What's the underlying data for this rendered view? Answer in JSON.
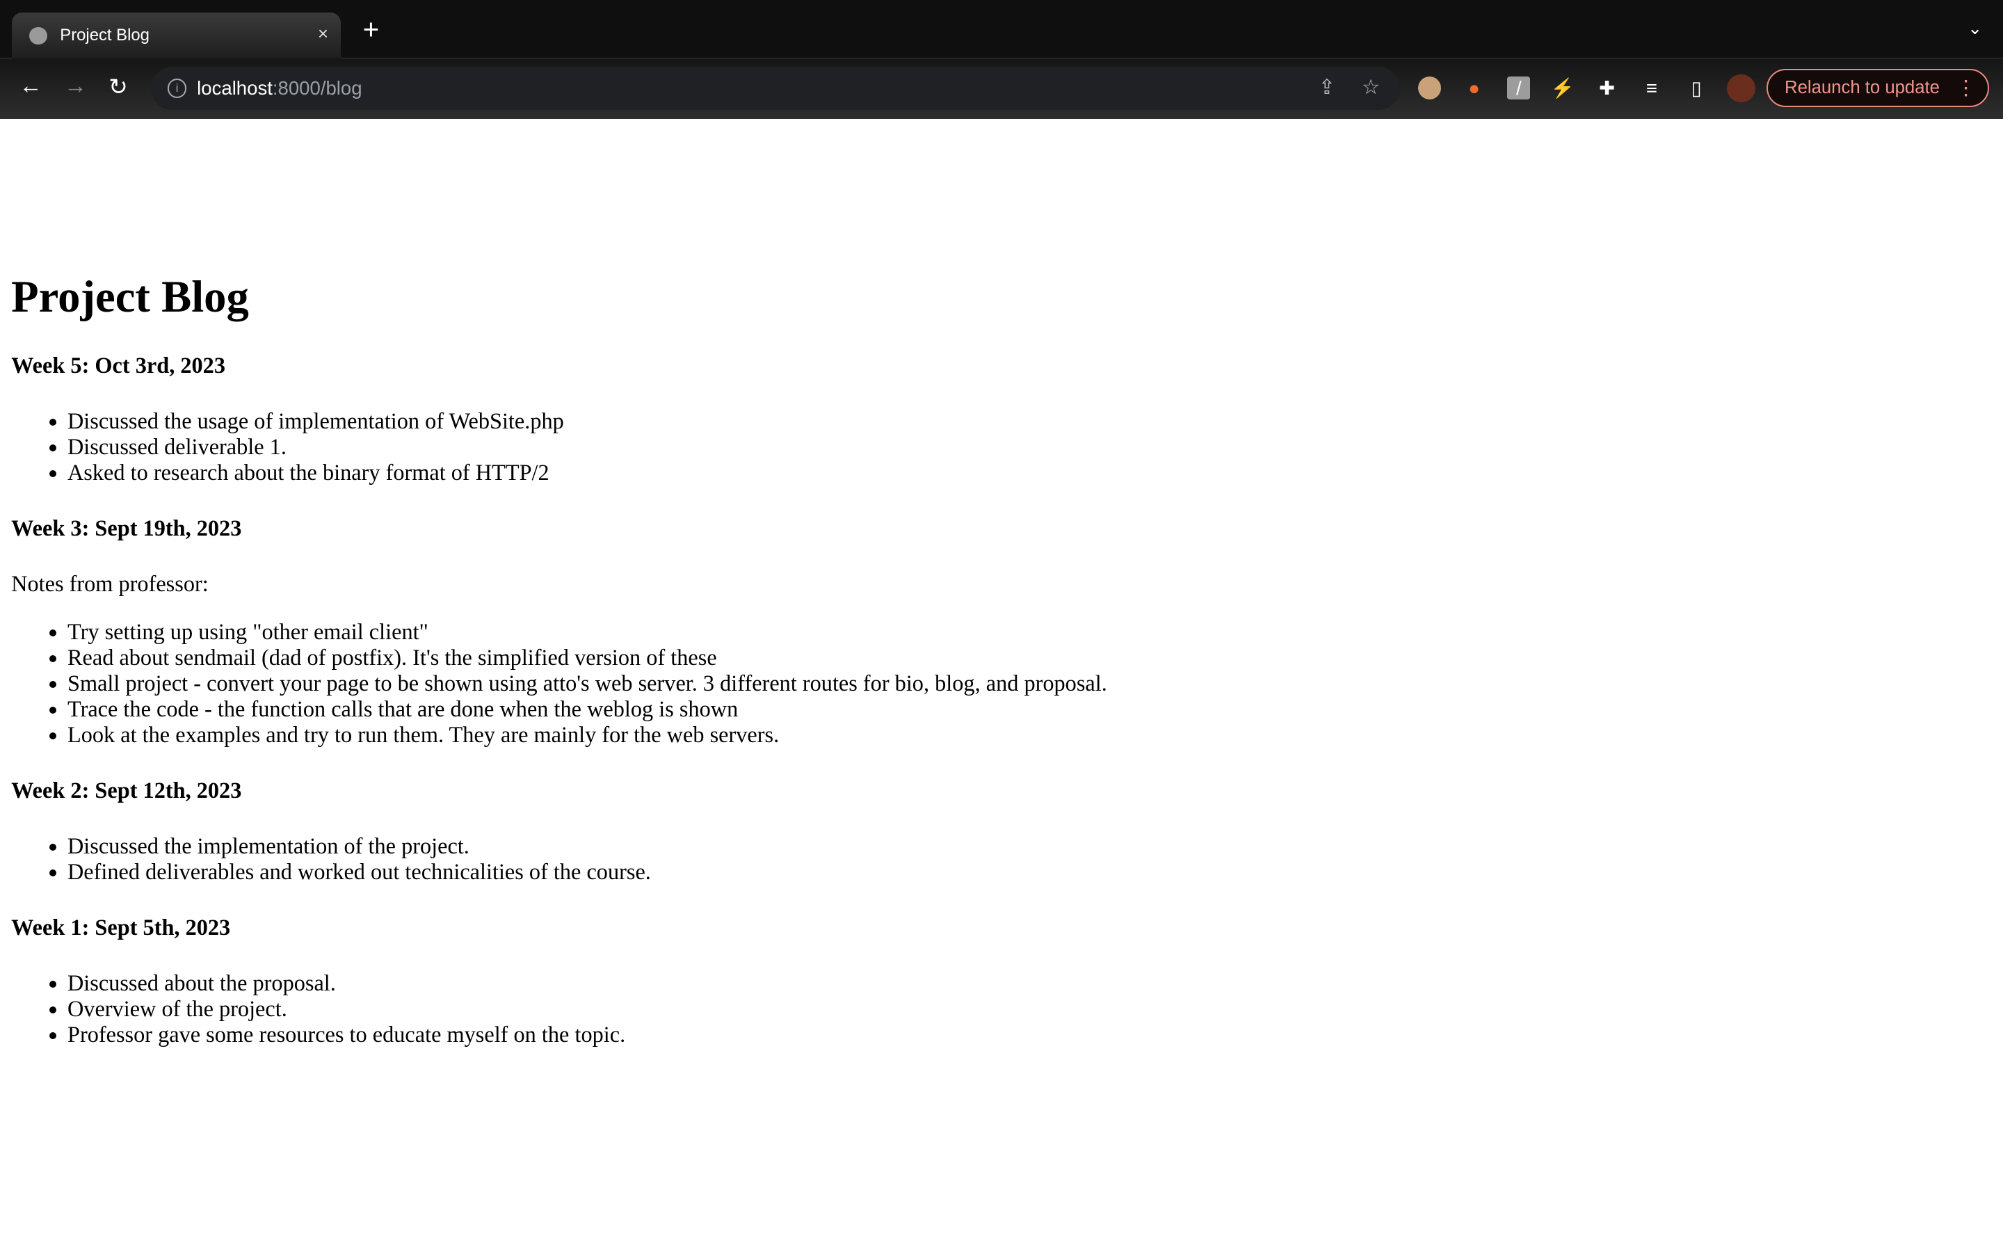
{
  "browser": {
    "tab_title": "Project Blog",
    "tab_close": "×",
    "new_tab": "+",
    "tab_menu": "⌄",
    "url_host": "localhost",
    "url_path": ":8000/blog",
    "relaunch_label": "Relaunch to update",
    "menu_icon": "⋮",
    "accent_color": "#e8897f"
  },
  "page": {
    "title": "Project Blog",
    "sections": [
      {
        "heading": "Week 5: Oct 3rd, 2023",
        "items": [
          "Discussed the usage of implementation of WebSite.php",
          "Discussed deliverable 1.",
          "Asked to research about the binary format of HTTP/2"
        ]
      },
      {
        "heading": "Week 3: Sept 19th, 2023",
        "note": "Notes from professor:",
        "items": [
          "Try setting up using \"other email client\"",
          "Read about sendmail (dad of postfix). It's the simplified version of these",
          "Small project - convert your page to be shown using atto's web server. 3 different routes for bio, blog, and proposal.",
          "Trace the code - the function calls that are done when the weblog is shown",
          "Look at the examples and try to run them. They are mainly for the web servers."
        ]
      },
      {
        "heading": "Week 2: Sept 12th, 2023",
        "items": [
          "Discussed the implementation of the project.",
          "Defined deliverables and worked out technicalities of the course."
        ]
      },
      {
        "heading": "Week 1: Sept 5th, 2023",
        "items": [
          "Discussed about the proposal.",
          "Overview of the project.",
          "Professor gave some resources to educate myself on the topic."
        ]
      }
    ]
  }
}
